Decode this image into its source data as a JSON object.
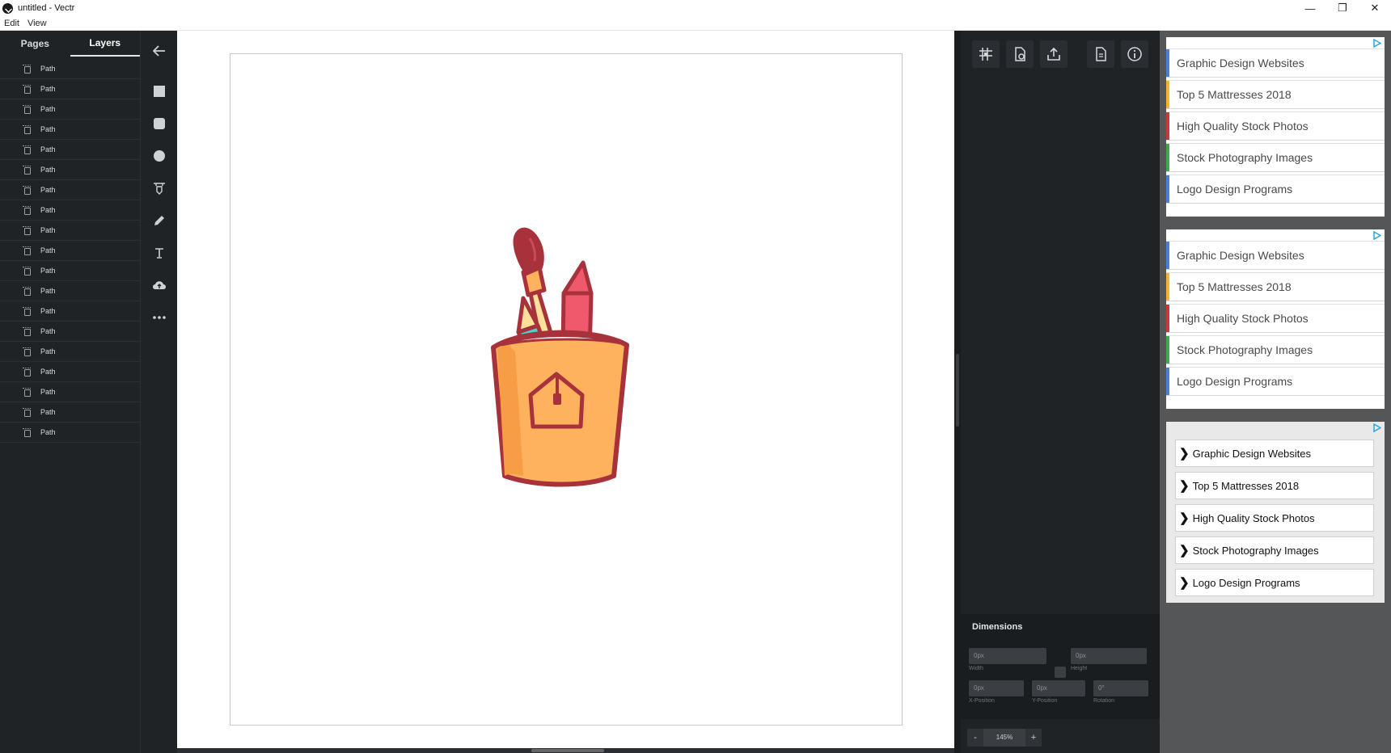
{
  "window": {
    "title": "untitled - Vectr",
    "controls": [
      "—",
      "❐",
      "✕"
    ]
  },
  "menu": [
    "Edit",
    "View"
  ],
  "left_panel": {
    "tabs": [
      "Pages",
      "Layers"
    ],
    "active_tab": "Layers",
    "layers": [
      "Path",
      "Path",
      "Path",
      "Path",
      "Path",
      "Path",
      "Path",
      "Path",
      "Path",
      "Path",
      "Path",
      "Path",
      "Path",
      "Path",
      "Path",
      "Path",
      "Path",
      "Path",
      "Path"
    ]
  },
  "tools": [
    "back-arrow",
    "rectangle",
    "rounded-rectangle",
    "ellipse",
    "pen",
    "pencil",
    "text",
    "upload",
    "more"
  ],
  "props_toolbar": [
    "grid-icon",
    "page-settings-icon",
    "export-icon",
    "document-icon",
    "info-icon"
  ],
  "dimensions": {
    "title": "Dimensions",
    "width": {
      "value": "0px",
      "label": "Width"
    },
    "height": {
      "value": "0px",
      "label": "Height"
    },
    "x": {
      "value": "0px",
      "label": "X-Position"
    },
    "y": {
      "value": "0px",
      "label": "Y-Position"
    },
    "rotation": {
      "value": "0°",
      "label": "Rotation"
    }
  },
  "zoom": {
    "minus": "-",
    "value": "145%",
    "plus": "+"
  },
  "ads": {
    "block1": [
      "Graphic Design Websites",
      "Top 5 Mattresses 2018",
      "High Quality Stock Photos",
      "Stock Photography Images",
      "Logo Design Programs"
    ],
    "block2": [
      "Graphic Design Websites",
      "Top 5 Mattresses 2018",
      "High Quality Stock Photos",
      "Stock Photography Images",
      "Logo Design Programs"
    ],
    "block3": [
      "Graphic Design Websites",
      "Top 5 Mattresses 2018",
      "High Quality Stock Photos",
      "Stock Photography Images",
      "Logo Design Programs"
    ],
    "bar_colors": [
      "#4a7fd4",
      "#f2b233",
      "#c8373a",
      "#3fa84c",
      "#4a7fd4"
    ]
  },
  "colors": {
    "cup_body": "#ffb25e",
    "cup_outline": "#a8323c",
    "brush_head": "#a8323c",
    "pencil_teal": "#4fd0cf",
    "crayon_red": "#f0596b"
  }
}
